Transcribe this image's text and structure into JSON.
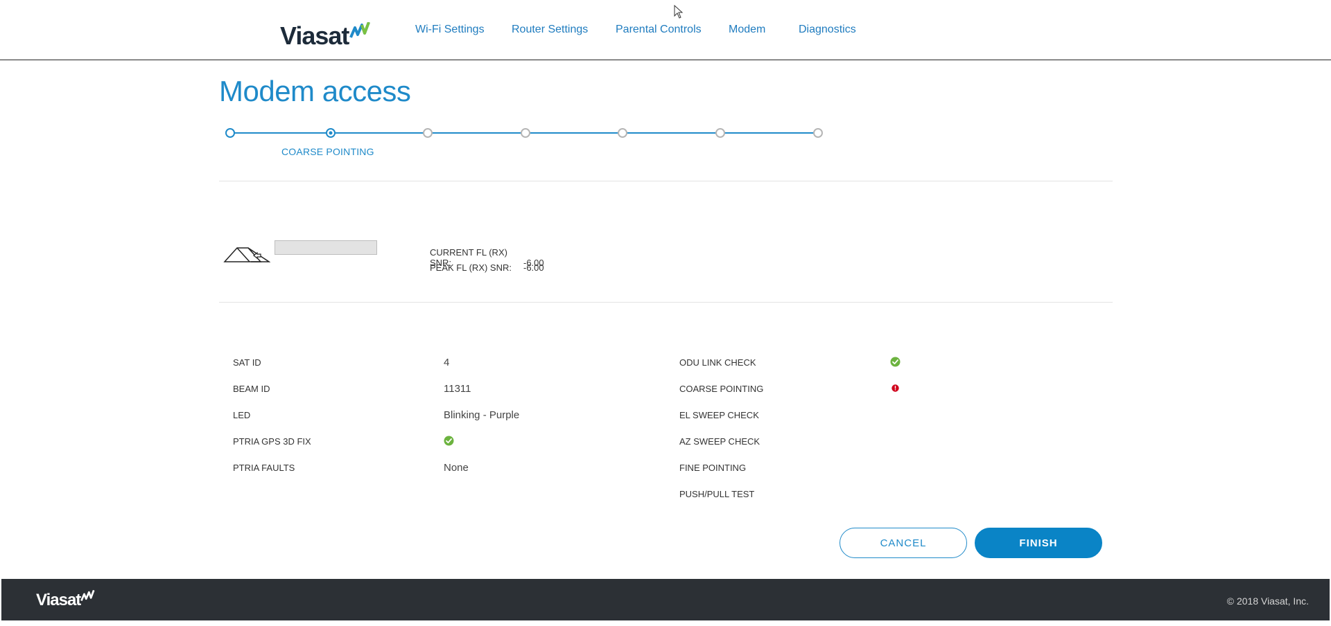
{
  "brand": {
    "name": "Viasat",
    "accent": "#1f8ac9",
    "footer_bg": "#2c3035"
  },
  "nav": {
    "items": [
      {
        "label": "Wi-Fi Settings"
      },
      {
        "label": "Router Settings"
      },
      {
        "label": "Parental Controls"
      },
      {
        "label": "Modem"
      },
      {
        "label": "Diagnostics"
      }
    ]
  },
  "page": {
    "title": "Modem access"
  },
  "stepper": {
    "total_steps": 7,
    "current_step": 2,
    "current_label": "COARSE POINTING"
  },
  "snr": {
    "current_label": "CURRENT FL (RX) SNR:",
    "current_value": "-6.00",
    "peak_label": "PEAK FL (RX) SNR:",
    "peak_value": "-6.00"
  },
  "status_left": [
    {
      "label": "SAT ID",
      "value": "4"
    },
    {
      "label": "BEAM ID",
      "value": "11311"
    },
    {
      "label": "LED",
      "value": "Blinking - Purple"
    },
    {
      "label": "PTRIA GPS 3D FIX",
      "icon": "check-circle-icon"
    },
    {
      "label": "PTRIA FAULTS",
      "value": "None"
    }
  ],
  "status_right": [
    {
      "label": "ODU LINK CHECK",
      "icon": "check-circle-icon"
    },
    {
      "label": "COARSE POINTING",
      "icon": "error-dot-icon"
    },
    {
      "label": "EL SWEEP CHECK"
    },
    {
      "label": "AZ SWEEP CHECK"
    },
    {
      "label": "FINE POINTING"
    },
    {
      "label": "PUSH/PULL TEST"
    }
  ],
  "status_colors": {
    "ok": "#6cb33f",
    "error": "#d0021b"
  },
  "buttons": {
    "cancel": "CANCEL",
    "finish": "FINISH"
  },
  "footer": {
    "copyright": "© 2018 Viasat, Inc."
  }
}
